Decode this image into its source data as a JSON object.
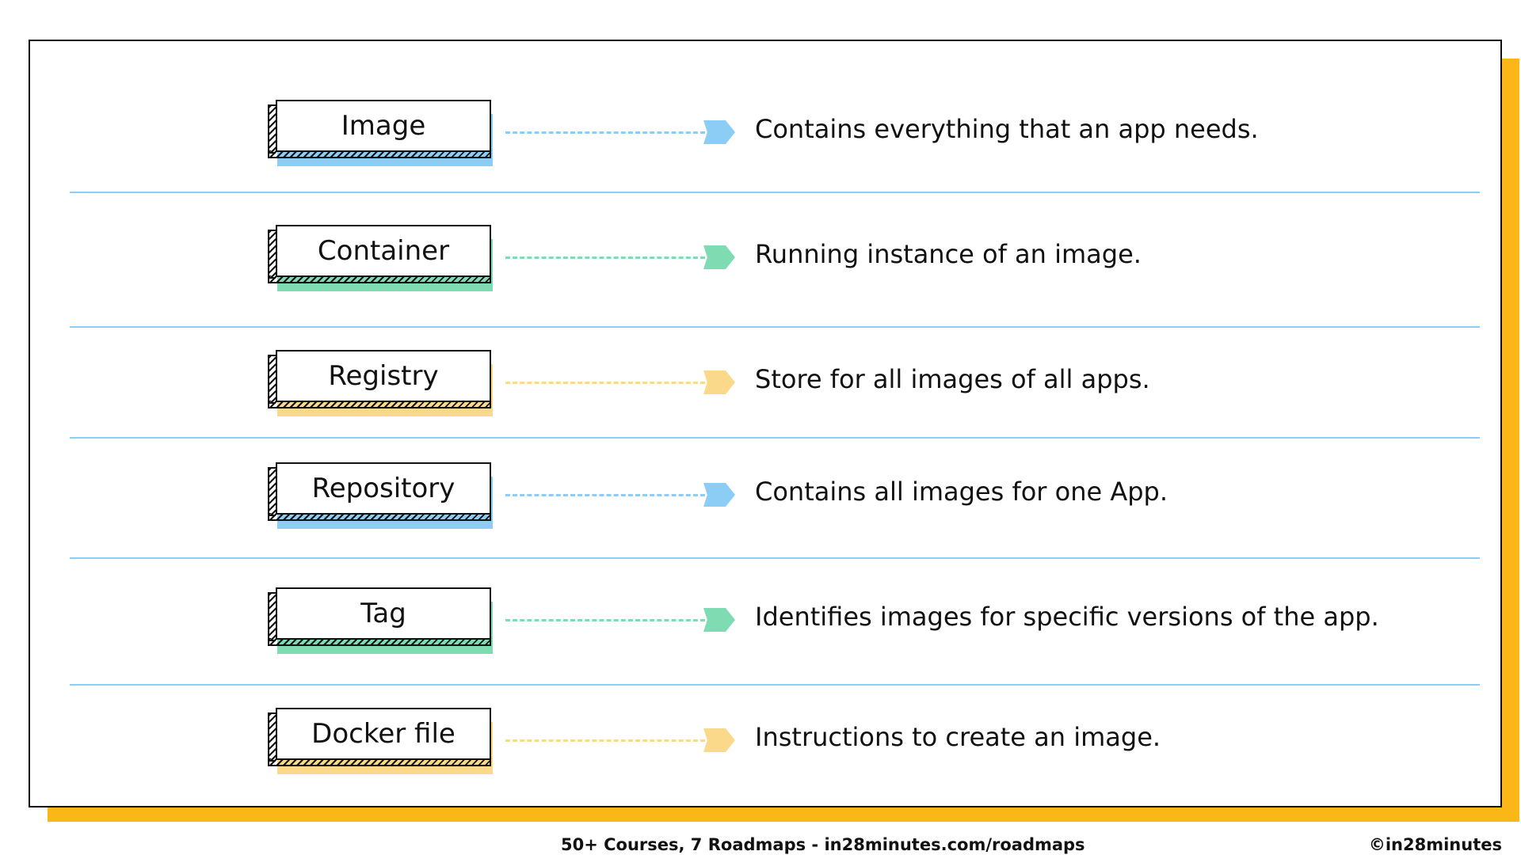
{
  "colors": {
    "blue": "#8ccdf5",
    "green": "#7fdcb2",
    "yellow": "#fbd98a",
    "frame_shadow": "#fbb617"
  },
  "rows": [
    {
      "term": "Image",
      "definition": "Contains everything that an app needs.",
      "accent": "blue"
    },
    {
      "term": "Container",
      "definition": "Running instance of an image.",
      "accent": "green"
    },
    {
      "term": "Registry",
      "definition": "Store for all images of all apps.",
      "accent": "yellow"
    },
    {
      "term": "Repository",
      "definition": "Contains all images for one App.",
      "accent": "blue"
    },
    {
      "term": "Tag",
      "definition": "Identifies images for specific versions of the  app.",
      "accent": "green"
    },
    {
      "term": "Docker file",
      "definition": "Instructions to create an image.",
      "accent": "yellow"
    }
  ],
  "footer": {
    "left": "50+ Courses, 7 Roadmaps - in28minutes.com/roadmaps",
    "right": "©in28minutes"
  }
}
